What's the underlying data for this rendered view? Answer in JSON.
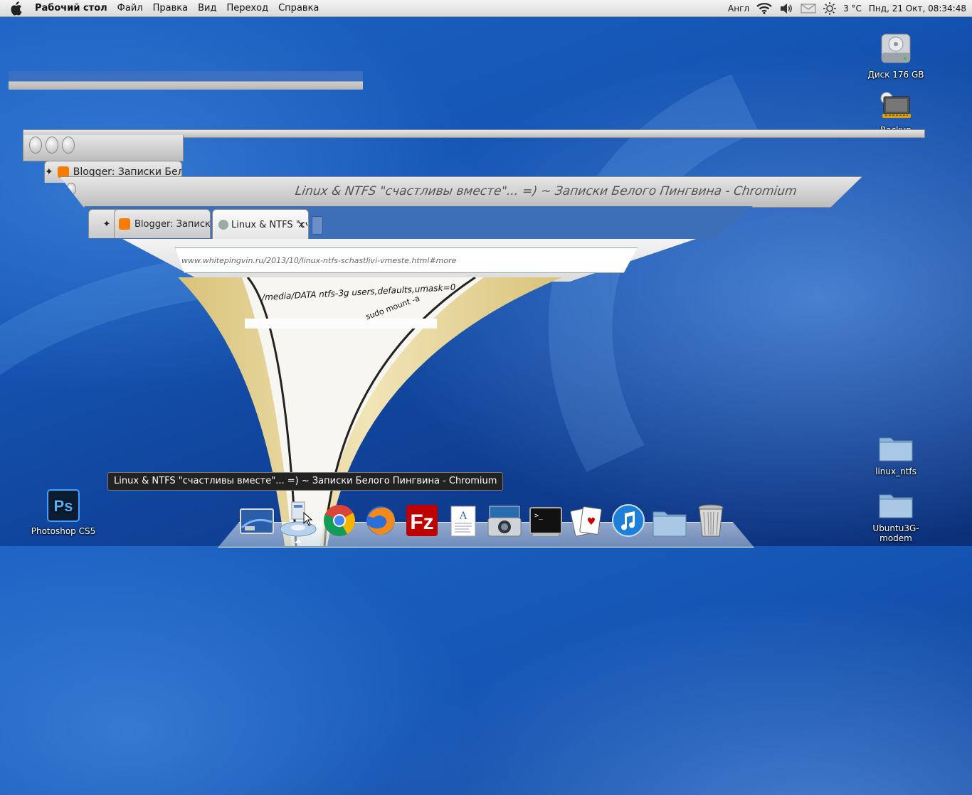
{
  "menubar": {
    "app_name": "Рабочий стол",
    "menus": [
      "Файл",
      "Правка",
      "Вид",
      "Переход",
      "Справка"
    ],
    "keyboard_layout": "Англ",
    "temperature": "3 °C",
    "datetime": "Пнд, 21 Окт, 08:34:48"
  },
  "desktop_icons": {
    "disk": "Диск 176 GB",
    "backup": "Backup",
    "linux_ntfs": "linux_ntfs",
    "modem": "Ubuntu3G-modem",
    "photoshop": "Photoshop CS5"
  },
  "window": {
    "title": "Linux & NTFS \"счастливы вместе\"... =) ~ Записки Белого Пингвина - Chromium",
    "tab1": "Blogger: Записки Бел",
    "tab2": "Linux & NTFS \"счастли",
    "url": "www.whitepingvin.ru/2013/10/linux-ntfs-schastlivi-vmeste.html#more",
    "content_line1": "/media/DATA ntfs-3g users,defaults,umask=0",
    "content_line2": "sudo mount -a"
  },
  "tooltip": "Linux & NTFS \"счастливы вместе\"... =) ~ Записки Белого Пингвина - Chromium",
  "dock": {
    "items": [
      "Рабочий стол",
      "Chromium",
      "Chrome",
      "Firefox",
      "FileZilla",
      "Текстовый редактор",
      "Снимок экрана",
      "Терминал",
      "Пасьянс",
      "Rhythmbox",
      "Папка",
      "Корзина"
    ]
  }
}
